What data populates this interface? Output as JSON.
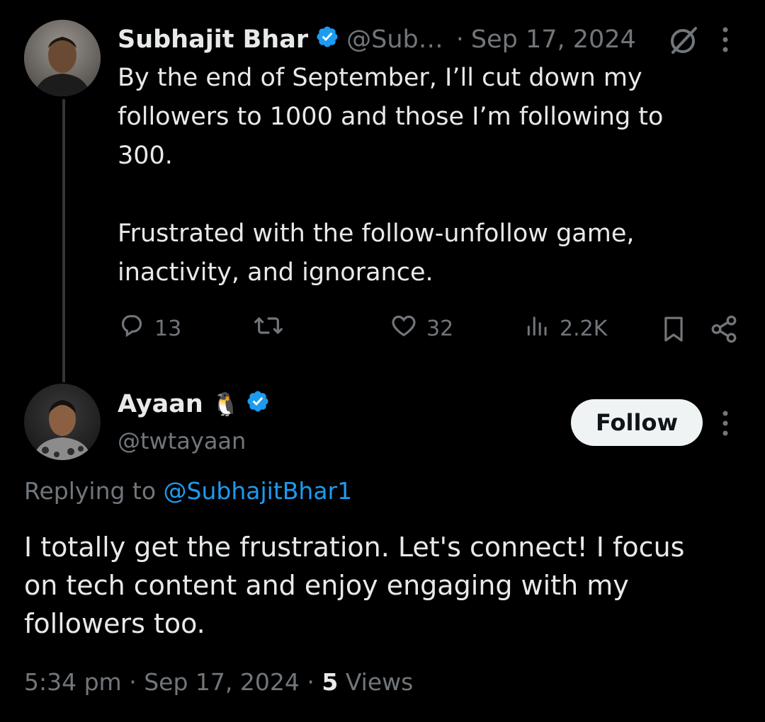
{
  "original_tweet": {
    "author_name": "Subhajit Bhar",
    "handle": "@Sub…",
    "separator": "·",
    "date": "Sep 17, 2024",
    "text": "By the end of September, I’ll cut down my\nfollowers to 1000 and those I’m following to\n300.\n\nFrustrated with the follow-unfollow game,\ninactivity, and ignorance.",
    "actions": {
      "replies": "13",
      "retweets": "",
      "likes": "32",
      "views": "2.2K"
    }
  },
  "reply_tweet": {
    "author_name": "Ayaan",
    "author_emoji": "🐧",
    "handle": "@twtayaan",
    "follow_label": "Follow",
    "replying_to_prefix": "Replying to",
    "replying_to_handle": "@SubhajitBhar1",
    "text": "I totally get the frustration. Let's connect! I focus\non tech content and enjoy engaging with my\nfollowers too.",
    "time": "5:34 pm",
    "dot1": "·",
    "date": "Sep 17, 2024",
    "dot2": "·",
    "views_count": "5",
    "views_label": "Views"
  },
  "colors": {
    "background": "#000000",
    "text": "#e7e9ea",
    "muted": "#71767b",
    "link": "#1d9bf0",
    "verified": "#1d9bf0",
    "thread_line": "#333639",
    "follow_bg": "#eff3f4"
  },
  "icons": {
    "verified": "verified-badge-icon",
    "grok": "grok-icon",
    "more": "more-vertical-icon",
    "reply": "reply-icon",
    "retweet": "retweet-icon",
    "like": "heart-icon",
    "views": "views-icon",
    "bookmark": "bookmark-icon",
    "share": "share-icon"
  }
}
